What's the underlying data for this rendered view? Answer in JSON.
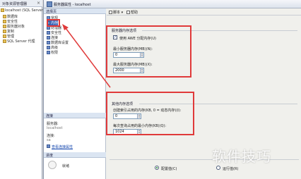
{
  "explorer": {
    "header": "对象资源管理器",
    "items": [
      {
        "label": "localhost (SQL Server 10"
      },
      {
        "label": "数据库"
      },
      {
        "label": "安全性"
      },
      {
        "label": "服务器对象"
      },
      {
        "label": "复制"
      },
      {
        "label": "管理"
      },
      {
        "label": "SQL Server 代理"
      }
    ]
  },
  "dialog": {
    "title": "服务器属性 - localhost"
  },
  "pages": {
    "header": "选择页",
    "items": [
      {
        "label": "常规"
      },
      {
        "label": "内存"
      },
      {
        "label": "处理器"
      },
      {
        "label": "安全性"
      },
      {
        "label": "连接"
      },
      {
        "label": "数据库设置"
      },
      {
        "label": "高级"
      },
      {
        "label": "权限"
      }
    ],
    "connection": {
      "header": "连接",
      "server_label": "服务器:",
      "server_value": "localhost",
      "conn_label": "连接:",
      "conn_value": "sa",
      "view_link": "查看连接属性"
    },
    "progress": {
      "header": "进度",
      "status": "就绪"
    }
  },
  "toolbar": {
    "script": "脚本",
    "help": "帮助"
  },
  "memory": {
    "group_title": "服务器内存选项",
    "awe_label": "使用 AWE 分配内存(U)",
    "awe_checked": true,
    "min_label": "最小服务器内存(MB)(N):",
    "min_value": "0",
    "max_label": "最大服务器内存(MB)(X):",
    "max_value": "2000"
  },
  "other": {
    "group_title": "其他内存选项",
    "index_label": "创建索引占用的内存(KB, 0 = 动态内存)(I):",
    "index_value": "0",
    "query_label": "每次查询占用的最小内存(KB)(Q):",
    "query_value": "1024"
  },
  "radios": {
    "configured": "配置值(C)",
    "running": "运行值(R)"
  },
  "watermark": "软件技巧",
  "colors": {
    "annotation_red": "#e03a3a",
    "selection_blue": "#3a64b8"
  }
}
